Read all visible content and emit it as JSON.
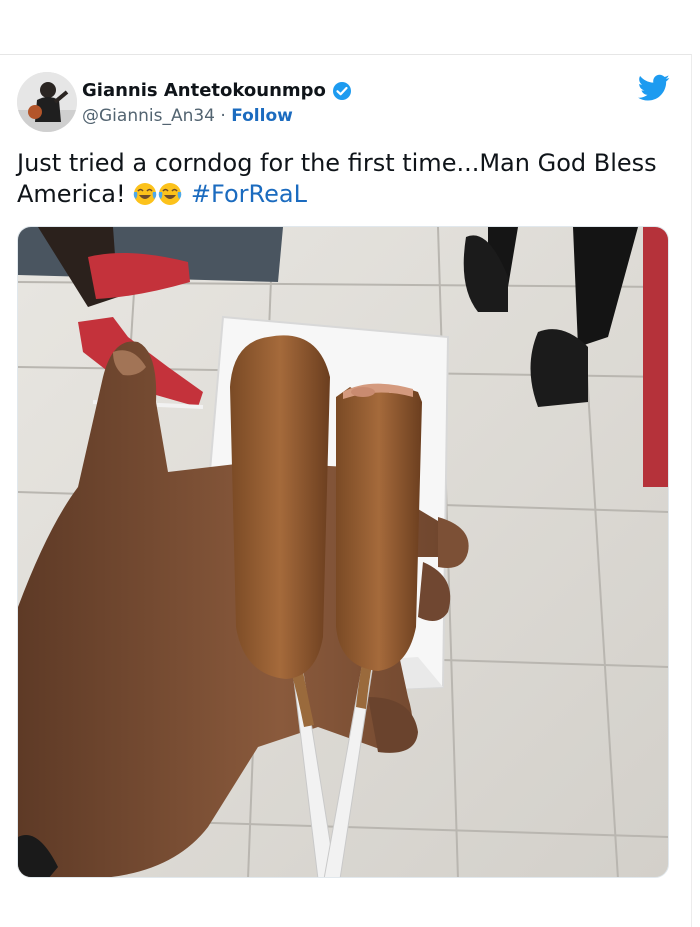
{
  "tweet": {
    "author_name": "Giannis Antetokounmpo",
    "author_handle": "@Giannis_An34",
    "separator": "·",
    "follow_label": "Follow",
    "text": "Just tried a corndog for the first time...Man God Bless America!",
    "emojis": [
      "face-with-tears-of-joy",
      "face-with-tears-of-joy"
    ],
    "hashtag": "#ForReaL",
    "verified": true
  },
  "colors": {
    "link": "#1b6bbf",
    "twitter_blue": "#1d9bf0",
    "text": "#0f1419",
    "secondary": "#536471"
  },
  "icons": {
    "brand": "twitter-bird-icon",
    "badge": "verified-badge-icon"
  }
}
